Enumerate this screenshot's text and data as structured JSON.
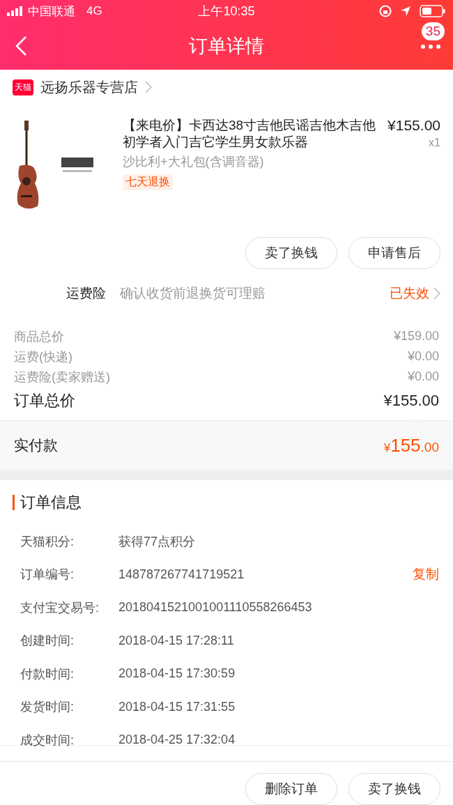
{
  "status_bar": {
    "carrier": "中国联通",
    "network": "4G",
    "time": "上午10:35"
  },
  "nav": {
    "title": "订单详情",
    "badge": "35"
  },
  "shop": {
    "badge": "天猫",
    "name": "远扬乐器专营店"
  },
  "product": {
    "title": "【来电价】卡西达38寸吉他民谣吉他木吉他初学者入门吉它学生男女款乐器",
    "price": "¥155.00",
    "quantity": "x1",
    "variant": "沙比利+大礼包(含调音器)",
    "tag": "七天退换"
  },
  "item_actions": [
    "卖了换钱",
    "申请售后"
  ],
  "insurance": {
    "label": "运费险",
    "description": "确认收货前退换货可理赔",
    "status": "已失效"
  },
  "costs": [
    {
      "label": "商品总价",
      "value": "¥159.00"
    },
    {
      "label": "运费(快递)",
      "value": "¥0.00"
    },
    {
      "label": "运费险(卖家赠送)",
      "value": "¥0.00"
    }
  ],
  "total": {
    "label": "订单总价",
    "value": "¥155.00"
  },
  "paid": {
    "label": "实付款",
    "currency": "¥",
    "integer": "155",
    "decimal": ".00"
  },
  "order_info": {
    "title": "订单信息",
    "rows": [
      {
        "label": "天猫积分:",
        "value": "获得77点积分"
      },
      {
        "label": "订单编号:",
        "value": "148787267741719521",
        "action": "复制"
      },
      {
        "label": "支付宝交易号:",
        "value": "2018041521001001110558266453"
      },
      {
        "label": "创建时间:",
        "value": "2018-04-15 17:28:11"
      },
      {
        "label": "付款时间:",
        "value": "2018-04-15 17:30:59"
      },
      {
        "label": "发货时间:",
        "value": "2018-04-15 17:31:55"
      },
      {
        "label": "成交时间:",
        "value": "2018-04-25 17:32:04"
      }
    ]
  },
  "footer_actions": [
    "删除订单",
    "卖了换钱"
  ]
}
